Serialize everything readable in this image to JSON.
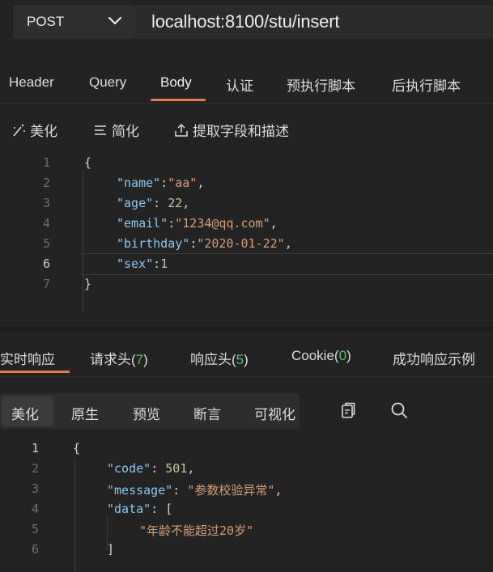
{
  "request": {
    "method": "POST",
    "url": "localhost:8100/stu/insert"
  },
  "request_tabs": [
    {
      "label": "Header"
    },
    {
      "label": "Query"
    },
    {
      "label": "Body"
    },
    {
      "label": "认证"
    },
    {
      "label": "预执行脚本"
    },
    {
      "label": "后执行脚本"
    }
  ],
  "body_tools": {
    "beautify": "美化",
    "simplify": "简化",
    "extract": "提取字段和描述"
  },
  "body_editor": {
    "line_numbers": [
      "1",
      "2",
      "3",
      "4",
      "5",
      "6",
      "7"
    ],
    "current_line": "6",
    "l1_brace": "{",
    "l2_key": "\"name\"",
    "l2_val": "\"aa\"",
    "l3_key": "\"age\"",
    "l3_val": "22",
    "l4_key": "\"email\"",
    "l4_val": "\"1234@qq.com\"",
    "l5_key": "\"birthday\"",
    "l5_val": "\"2020-01-22\"",
    "l6_key": "\"sex\"",
    "l6_val": "1",
    "l7_brace": "}"
  },
  "response_tabs": {
    "realtime": "实时响应",
    "req_headers": "请求头",
    "req_headers_count": "7",
    "resp_headers": "响应头",
    "resp_headers_count": "5",
    "cookie": "Cookie",
    "cookie_count": "0",
    "success_example": "成功响应示例"
  },
  "response_views": [
    "美化",
    "原生",
    "预览",
    "断言",
    "可视化"
  ],
  "response_editor": {
    "line_numbers": [
      "1",
      "2",
      "3",
      "4",
      "5",
      "6"
    ],
    "l1_brace": "{",
    "l2_key": "\"code\"",
    "l2_val": "501",
    "l3_key": "\"message\"",
    "l3_val": "\"参数校验异常\"",
    "l4_key": "\"data\"",
    "l4_open": "[",
    "l5_val": "\"年龄不能超过20岁\"",
    "l6_close": "]"
  },
  "colors": {
    "accent": "#e07a4f",
    "count_green": "#56c06a",
    "json_key": "#8fc7f0",
    "json_string": "#d69f7b",
    "json_number": "#b5cea8"
  },
  "icons": [
    "chevron-down-icon",
    "magic-wand-icon",
    "simplify-icon",
    "upload-icon",
    "copy-icon",
    "search-icon"
  ]
}
